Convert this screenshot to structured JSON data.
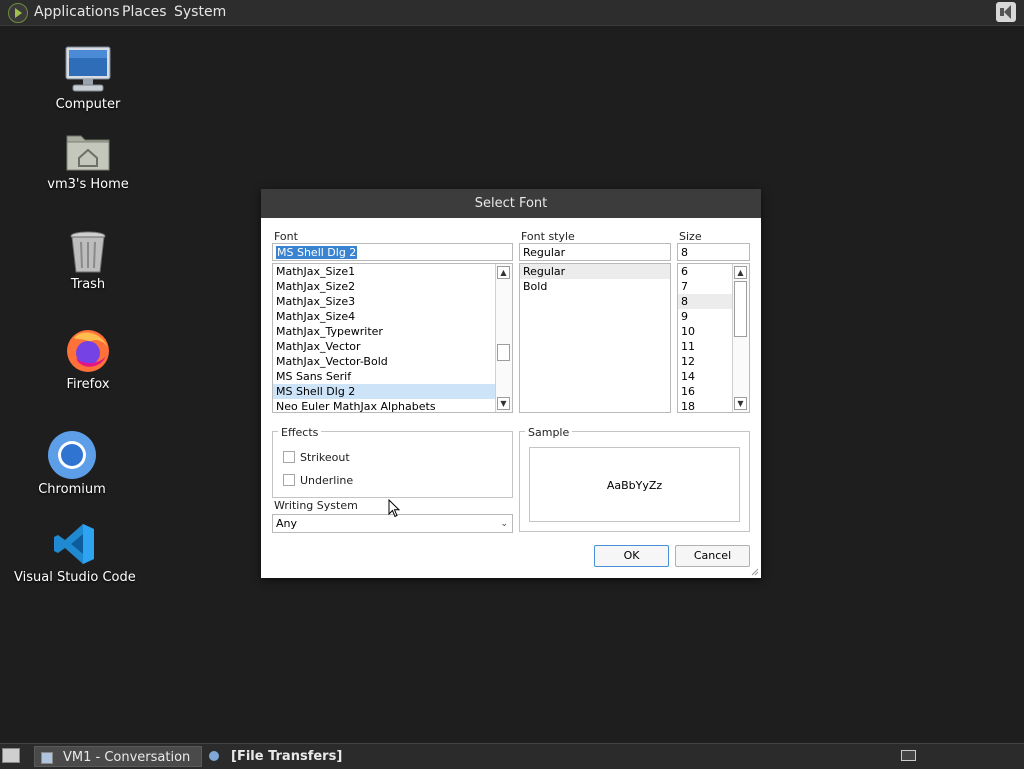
{
  "top_panel": {
    "menus": [
      "Applications",
      "Places",
      "System"
    ],
    "logo_icon": "applications-menu-icon",
    "volume_icon": "speaker-icon"
  },
  "desktop": {
    "icons": [
      {
        "label": "Computer",
        "icon": "computer-monitor-icon"
      },
      {
        "label": "vm3's Home",
        "icon": "home-folder-icon"
      },
      {
        "label": "Trash",
        "icon": "trash-icon"
      },
      {
        "label": "Firefox",
        "icon": "firefox-icon"
      },
      {
        "label": "Chromium",
        "icon": "chromium-icon"
      },
      {
        "label": "Visual Studio Code",
        "icon": "vscode-icon"
      }
    ]
  },
  "dialog": {
    "title": "Select Font",
    "font_label": "Font",
    "font_value": "MS Shell Dlg 2",
    "font_list": [
      "MathJax_Size1",
      "MathJax_Size2",
      "MathJax_Size3",
      "MathJax_Size4",
      "MathJax_Typewriter",
      "MathJax_Vector",
      "MathJax_Vector-Bold",
      "MS Sans Serif",
      "MS Shell Dlg 2",
      "Neo Euler MathJax Alphabets"
    ],
    "font_selected": "MS Shell Dlg 2",
    "style_label": "Font style",
    "style_value": "Regular",
    "style_list": [
      "Regular",
      "Bold"
    ],
    "size_label": "Size",
    "size_value": "8",
    "size_list": [
      "6",
      "7",
      "8",
      "9",
      "10",
      "11",
      "12",
      "14",
      "16",
      "18"
    ],
    "effects_label": "Effects",
    "strikeout_label": "Strikeout",
    "strikeout_checked": false,
    "underline_label": "Underline",
    "underline_checked": false,
    "sample_label": "Sample",
    "sample_text": "AaBbYyZz",
    "writing_system_label": "Writing System",
    "writing_system_value": "Any",
    "ok_label": "OK",
    "cancel_label": "Cancel"
  },
  "taskbar": {
    "tasks": [
      "VM1 - Conversation",
      "[File Transfers]"
    ]
  },
  "colors": {
    "desktop_bg": "#1e1e1e",
    "selection": "#3a83d1",
    "list_highlight": "#cde3f7"
  }
}
